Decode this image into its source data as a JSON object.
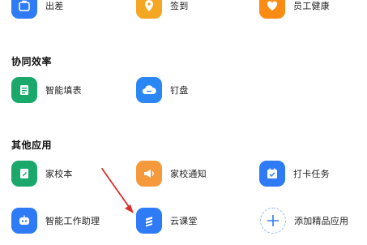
{
  "top_row": [
    {
      "label": "出差",
      "icon": "suitcase-icon",
      "color": "#2f7bf5"
    },
    {
      "label": "签到",
      "icon": "location-pin-icon",
      "color": "#f5a623"
    },
    {
      "label": "员工健康",
      "icon": "heart-icon",
      "color": "#fa8c16"
    }
  ],
  "collab": {
    "title": "协同效率",
    "items": [
      {
        "label": "智能填表",
        "icon": "form-document-icon",
        "color": "#1aa86b"
      },
      {
        "label": "钉盘",
        "icon": "cloud-drive-icon",
        "color": "#2b87f4"
      }
    ]
  },
  "other": {
    "title": "其他应用",
    "items": [
      {
        "label": "家校本",
        "icon": "homework-book-icon",
        "color": "#1aa86b"
      },
      {
        "label": "家校通知",
        "icon": "megaphone-icon",
        "color": "#f59a3c"
      },
      {
        "label": "打卡任务",
        "icon": "calendar-check-icon",
        "color": "#2f7bf5"
      },
      {
        "label": "智能工作助理",
        "icon": "robot-assistant-icon",
        "color": "#2f7bf5"
      },
      {
        "label": "云课堂",
        "icon": "cloud-classroom-icon",
        "color": "#2f7bf5"
      },
      {
        "label": "添加精品应用",
        "icon": "plus-icon",
        "color": "#2f7bf5"
      }
    ]
  },
  "annotation": {
    "arrow_color": "#d9302c"
  }
}
